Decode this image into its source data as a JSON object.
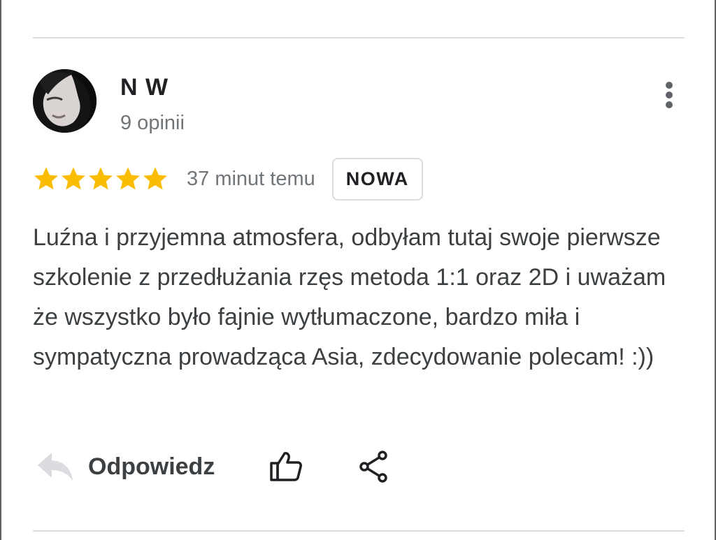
{
  "review": {
    "reviewer_name": "N W",
    "review_count": "9 opinii",
    "rating": 5,
    "rating_max": 5,
    "time": "37 minut temu",
    "badge": "NOWA",
    "text": "Luźna i przyjemna atmosfera, odbyłam tutaj swoje pierwsze szkolenie z przedłużania rzęs metoda 1:1 oraz 2D i uważam że wszystko było fajnie wytłumaczone, bardzo miła i sympatyczna prowadząca Asia, zdecydowanie polecam! :))"
  },
  "actions": {
    "reply_label": "Odpowiedz"
  },
  "icons": {
    "more": "more-vert-icon",
    "reply": "reply-arrow-icon",
    "like": "thumb-up-icon",
    "share": "share-icon",
    "star": "star-icon"
  },
  "colors": {
    "star": "#fbbc04",
    "text_primary": "#202124",
    "text_secondary": "#70757a",
    "divider": "#dadce0",
    "reply_icon": "#dadce0"
  }
}
